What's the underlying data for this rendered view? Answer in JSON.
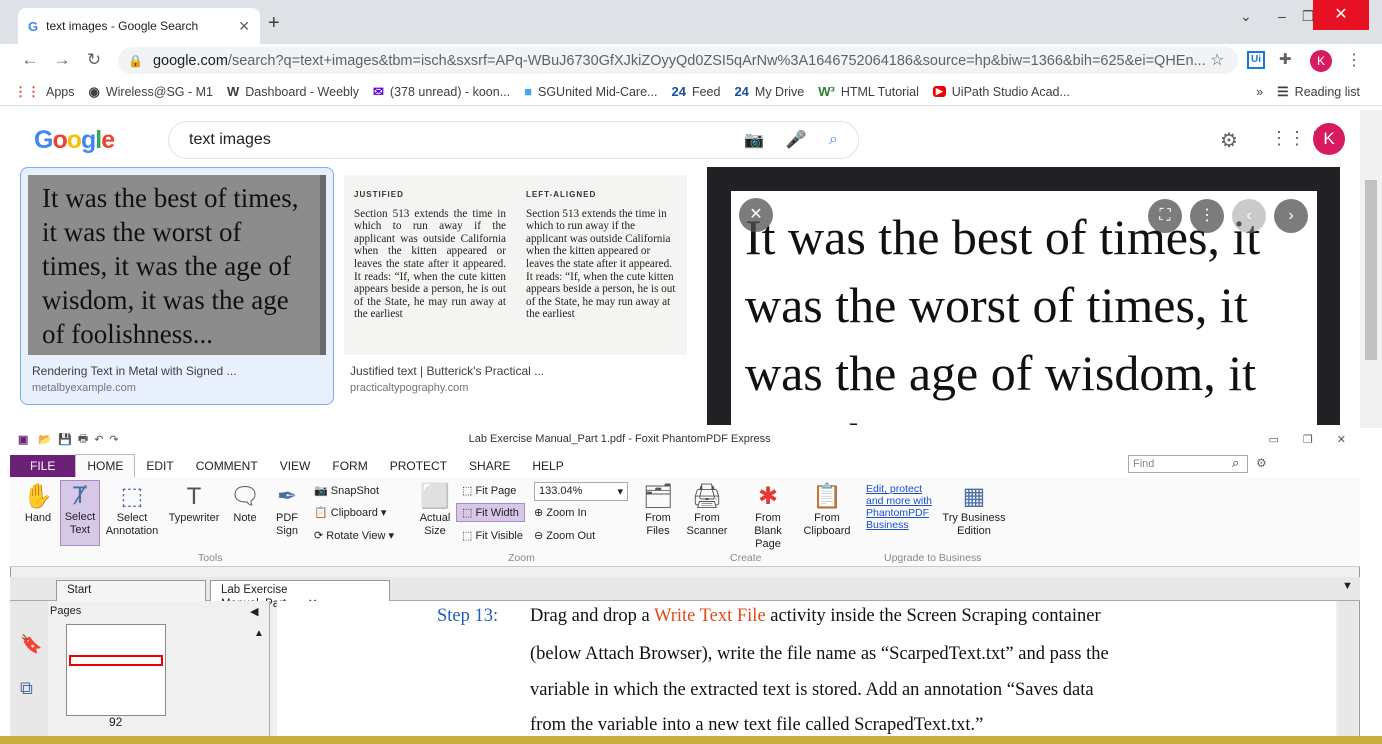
{
  "browser": {
    "tab_title": "text images - Google Search",
    "url_host": "google.com",
    "url_path": "/search?q=text+images&tbm=isch&sxsrf=APq-WBuJ6730GfXJkiZOyyQd0ZSI5qArNw%3A1646752064186&source=hp&biw=1366&bih=625&ei=QHEn...",
    "profile_initial": "K",
    "bookmarks": [
      "Apps",
      "Wireless@SG - M1",
      "Dashboard - Weebly",
      "(378 unread) - koon...",
      "SGUnited Mid-Care...",
      "Feed",
      "My Drive",
      "HTML Tutorial",
      "UiPath Studio Acad..."
    ],
    "reading_list": "Reading list"
  },
  "google": {
    "logo": "Google",
    "query": "text images",
    "avatar": "K",
    "results": [
      {
        "title": "Rendering Text in Metal with Signed ...",
        "source": "metalbyexample.com",
        "image_text": "It was the best of times, it was the worst of times, it was the age of wisdom, it was the age of foolishness..."
      },
      {
        "title": "Justified text | Butterick's Practical ...",
        "source": "practicaltypography.com",
        "col1_hdr": "JUSTIFIED",
        "col2_hdr": "LEFT-ALIGNED",
        "body": "Section 513 extends the time in which to run away if the applicant was outside California when the kitten appeared or leaves the state after it appeared. It reads: “If, when the cute kitten appears beside a person, he is out of the State, he may run away at the earliest"
      }
    ],
    "preview_text": "It was the best of times, it was the worst of times, it was the age of wisdom, it was the"
  },
  "foxit": {
    "title": "Lab Exercise Manual_Part 1.pdf - Foxit PhantomPDF Express",
    "menu": [
      "FILE",
      "HOME",
      "EDIT",
      "COMMENT",
      "VIEW",
      "FORM",
      "PROTECT",
      "SHARE",
      "HELP"
    ],
    "find_placeholder": "Find",
    "tools": {
      "hand": "Hand",
      "select_text": "Select Text",
      "select_annotation": "Select Annotation",
      "typewriter": "Typewriter",
      "note": "Note",
      "pdf_sign": "PDF Sign",
      "snapshot": "SnapShot",
      "clipboard": "Clipboard",
      "rotate_view": "Rotate View",
      "group": "Tools"
    },
    "zoom": {
      "actual_size": "Actual Size",
      "fit_page": "Fit Page",
      "fit_width": "Fit Width",
      "fit_visible": "Fit Visible",
      "zoom_value": "133.04%",
      "zoom_in": "Zoom In",
      "zoom_out": "Zoom Out",
      "group": "Zoom"
    },
    "create": {
      "from_files": "From Files",
      "from_scanner": "From Scanner",
      "from_blank": "From Blank Page",
      "from_clipboard": "From Clipboard",
      "group": "Create"
    },
    "upgrade": {
      "link": "Edit, protect and more with PhantomPDF Business",
      "try": "Try Business Edition",
      "group": "Upgrade to Business"
    },
    "doc_tabs": [
      "Start",
      "Lab Exercise Manual_Part..."
    ],
    "pages_label": "Pages",
    "page_number": "92",
    "step_label": "Step 13:",
    "doc_lines": [
      [
        "Drag and drop a ",
        "Write Text File",
        " activity inside the Screen Scraping container"
      ],
      "(below Attach Browser), write the file name as “ScarpedText.txt” and pass the",
      "variable in which the extracted text is stored. Add an annotation “Saves data",
      "from the variable into a new text file called ScrapedText.txt.”"
    ]
  }
}
